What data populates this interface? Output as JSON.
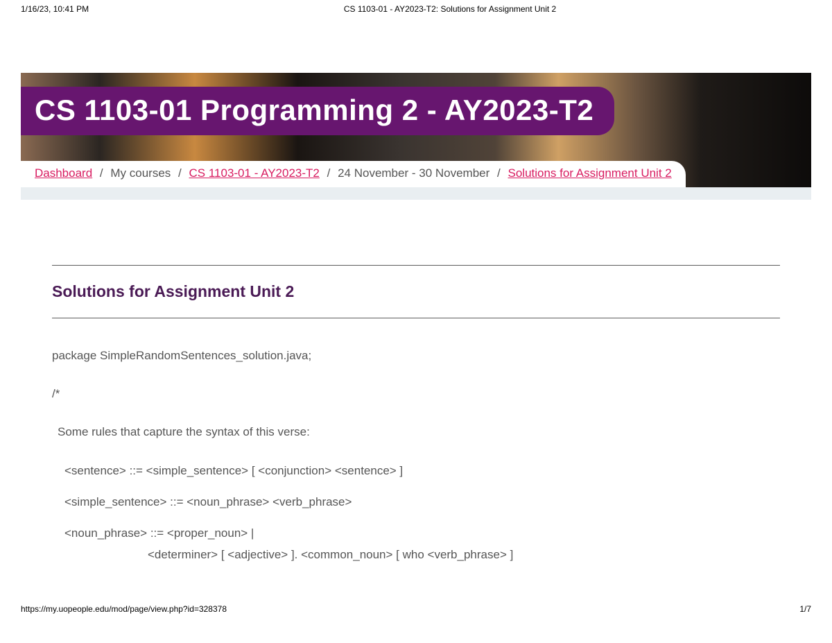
{
  "print": {
    "timestamp": "1/16/23, 10:41 PM",
    "title": "CS 1103-01 - AY2023-T2: Solutions for Assignment Unit 2",
    "url": "https://my.uopeople.edu/mod/page/view.php?id=328378",
    "page": "1/7"
  },
  "course_title": "CS 1103-01 Programming 2 - AY2023-T2",
  "breadcrumb": {
    "dashboard": "Dashboard",
    "my_courses": "My courses",
    "course_link": "CS 1103-01 - AY2023-T2",
    "week": "24 November - 30 November",
    "current": "Solutions for Assignment Unit 2"
  },
  "page_heading": "Solutions for Assignment Unit 2",
  "code": {
    "package_line": "package SimpleRandomSentences_solution.java;",
    "open_comment": "/*",
    "intro": "Some rules that capture the syntax of this verse:",
    "rule1": "<sentence> ::= <simple_sentence> [ <conjunction> <sentence> ]",
    "rule2": "<simple_sentence> ::= <noun_phrase> <verb_phrase>",
    "rule3a": "<noun_phrase> ::= <proper_noun> |",
    "rule3b": "<determiner> [ <adjective> ]. <common_noun> [ who <verb_phrase> ]"
  }
}
